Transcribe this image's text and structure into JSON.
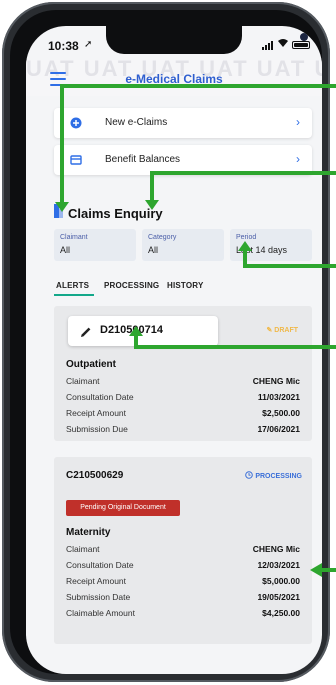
{
  "status_bar": {
    "time": "10:38",
    "location_glyph": "➚"
  },
  "app": {
    "title": "e-Medical Claims",
    "watermark": "UAT UAT UAT UAT UAT UAT UAT"
  },
  "menu": {
    "items": [
      {
        "label": "New e-Claims",
        "icon": "new-claim-icon",
        "chevron": "›"
      },
      {
        "label": "Benefit Balances",
        "icon": "balance-icon",
        "chevron": "›"
      }
    ]
  },
  "enquiry": {
    "title": "Claims Enquiry",
    "filters": [
      {
        "label": "Claimant",
        "value": "All"
      },
      {
        "label": "Category",
        "value": "All"
      },
      {
        "label": "Period",
        "value": "Last 14 days"
      }
    ],
    "tabs": [
      "ALERTS",
      "PROCESSING",
      "HISTORY"
    ]
  },
  "claims": [
    {
      "id": "D210500714",
      "status": "DRAFT",
      "type": "Outpatient",
      "rows": [
        {
          "k": "Claimant",
          "v": "CHENG Mic"
        },
        {
          "k": "Consultation Date",
          "v": "11/03/2021"
        },
        {
          "k": "Receipt Amount",
          "v": "$2,500.00"
        },
        {
          "k": "Submission Due",
          "v": "17/06/2021"
        }
      ]
    },
    {
      "id": "C210500629",
      "status": "PROCESSING",
      "badge": "Pending Original Document",
      "type": "Maternity",
      "rows": [
        {
          "k": "Claimant",
          "v": "CHENG Mic"
        },
        {
          "k": "Consultation Date",
          "v": "12/03/2021"
        },
        {
          "k": "Receipt Amount",
          "v": "$5,000.00"
        },
        {
          "k": "Submission Date",
          "v": "19/05/2021"
        },
        {
          "k": "Claimable Amount",
          "v": "$4,250.00"
        }
      ]
    }
  ],
  "colors": {
    "accent": "#2f6ee6",
    "tab_underline": "#13a88a",
    "draft": "#f0b94a",
    "badge": "#c0302a",
    "annotation_arrow": "#2ea62f"
  }
}
